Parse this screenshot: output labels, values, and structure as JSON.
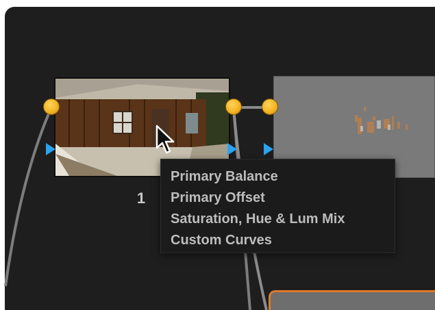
{
  "node_graph": {
    "nodes": [
      {
        "label": "1",
        "thumbnail": "cabin-photo-thumbnail"
      },
      {
        "label": "",
        "thumbnail": "gray-matte-thumbnail"
      },
      {
        "label": "",
        "thumbnail": "selected-node",
        "accent": "#e07a2a"
      }
    ],
    "connector_color": "#f4b524",
    "input_marker_color": "#2aa3f0",
    "link_color": "#8a8a8a"
  },
  "tooltip": {
    "lines": [
      "Primary Balance",
      "Primary Offset",
      "Saturation, Hue & Lum Mix",
      "Custom Curves"
    ]
  },
  "cursor": {
    "icon": "arrow-cursor-icon"
  }
}
